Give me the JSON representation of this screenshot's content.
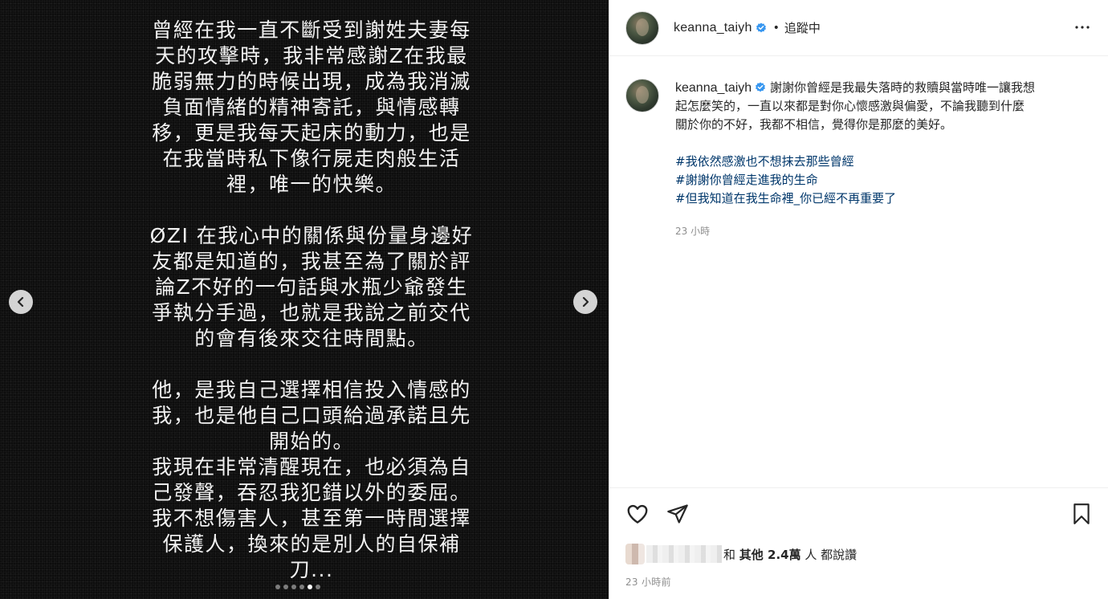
{
  "media": {
    "paragraphs": [
      "曾經在我一直不斷受到謝姓夫妻每\n天的攻擊時，我非常感謝Z在我最\n脆弱無力的時候出現，成為我消滅\n負面情緒的精神寄託，與情感轉\n移，更是我每天起床的動力，也是\n在我當時私下像行屍走肉般生活\n裡，唯一的快樂。",
      "ØZI 在我心中的關係與份量身邊好\n友都是知道的，我甚至為了關於評\n論Z不好的一句話與水瓶少爺發生\n爭執分手過，也就是我說之前交代\n的會有後來交往時間點。",
      "他，是我自己選擇相信投入情感的\n我，也是他自己口頭給過承諾且先\n開始的。",
      "我現在非常清醒現在，也必須為自\n己發聲，吞忍我犯錯以外的委屈。\n我不想傷害人，甚至第一時間選擇\n保護人，換來的是別人的自保補\n刀..."
    ],
    "carousel": {
      "total": 6,
      "active_index": 4
    },
    "prev_icon": "chevron-left-icon",
    "next_icon": "chevron-right-icon"
  },
  "header": {
    "username": "keanna_taiyh",
    "verified_icon": "verified-badge-icon",
    "separator": "•",
    "follow_label": "追蹤中",
    "more_icon": "more-options-icon"
  },
  "caption": {
    "username": "keanna_taiyh",
    "text": "謝謝你曾經是我最失落時的救贖與當時唯一讓我想\n起怎麼笑的，一直以來都是對你心懷感激與偏愛，不論我聽到什麼\n關於你的不好，我都不相信，覺得你是那麼的美好。",
    "hashtags": [
      "#我依然感激也不想抹去那些曾經",
      "#謝謝你曾經走進我的生命",
      "#但我知道在我生命裡_你已經不再重要了"
    ],
    "time": "23 小時"
  },
  "actions": {
    "like_icon": "heart-icon",
    "share_icon": "paper-plane-icon",
    "save_icon": "bookmark-icon"
  },
  "likes": {
    "prefix": "和",
    "others_label": "其他",
    "count": "2.4萬",
    "suffix": "人 都說讚"
  },
  "post_time": "23 小時前",
  "colors": {
    "hashtag": "#00376b",
    "verified": "#3897f0",
    "muted": "#8e8e8e"
  }
}
